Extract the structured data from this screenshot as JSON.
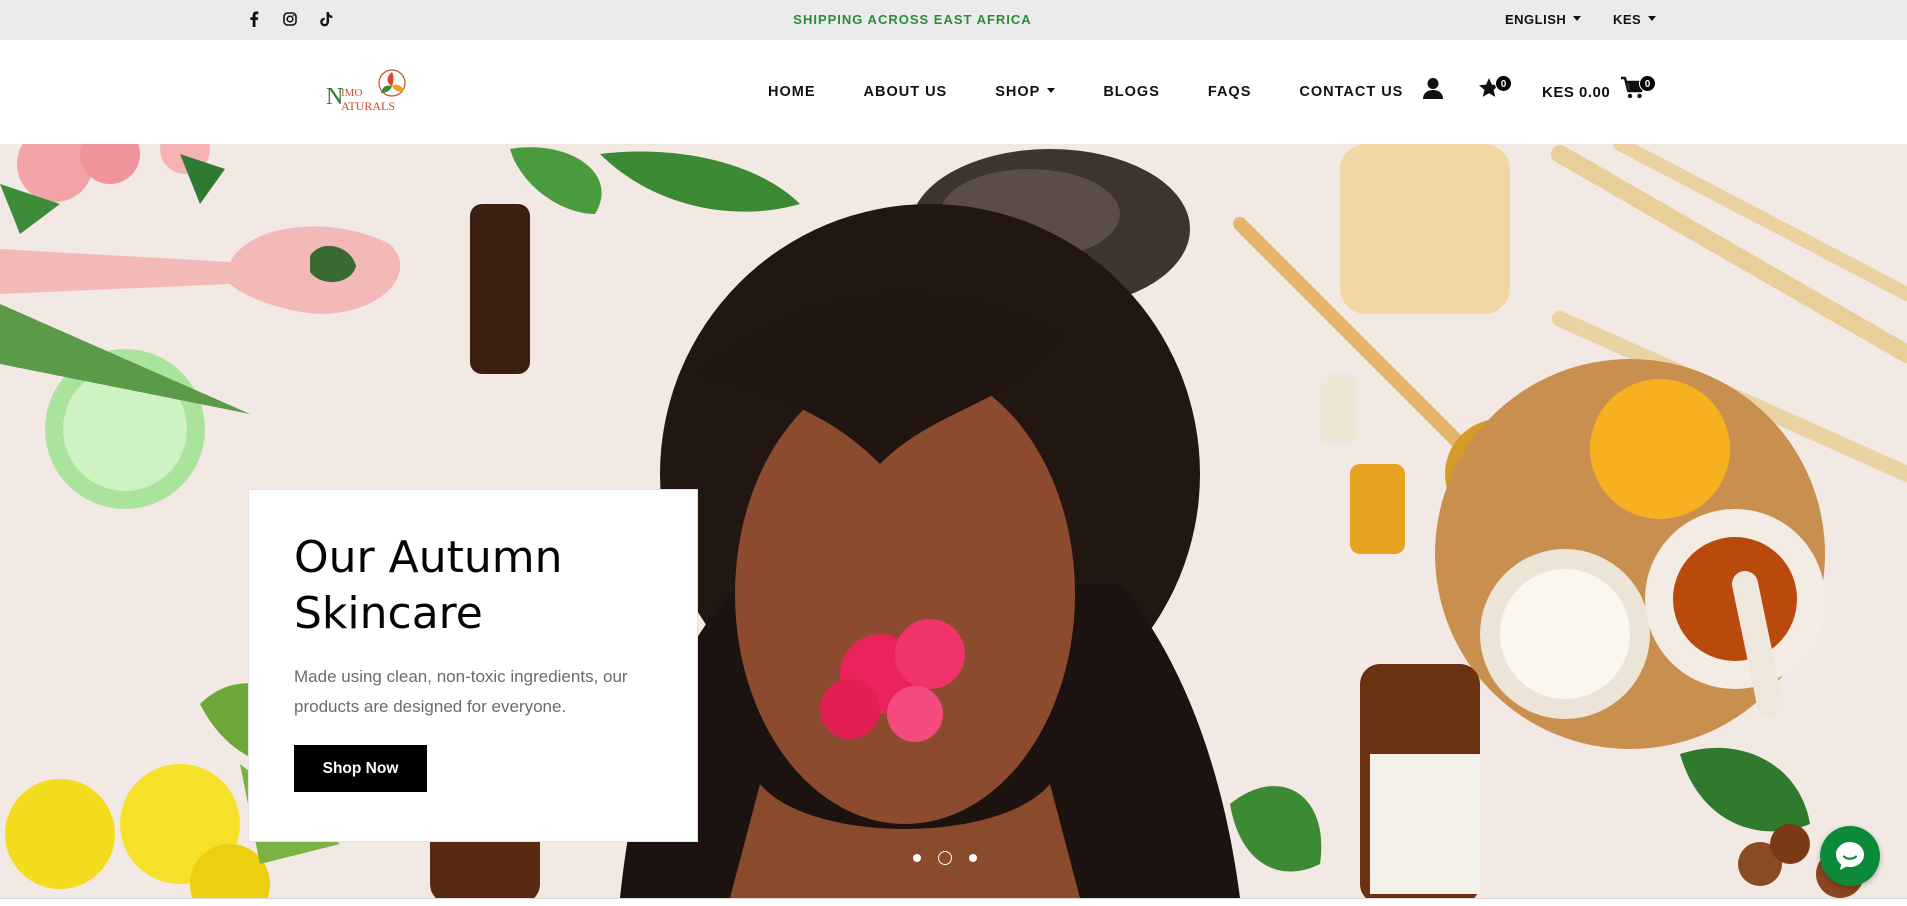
{
  "topbar": {
    "social": [
      {
        "icon": "facebook-icon"
      },
      {
        "icon": "instagram-icon"
      },
      {
        "icon": "tiktok-icon"
      }
    ],
    "shipping_text": "SHIPPING ACROSS EAST AFRICA",
    "language": "ENGLISH",
    "currency": "KES"
  },
  "header": {
    "logo_alt": "Nimo Naturals",
    "nav": [
      {
        "label": "HOME"
      },
      {
        "label": "ABOUT US"
      },
      {
        "label": "SHOP"
      },
      {
        "label": "BLOGS"
      },
      {
        "label": "FAQS"
      },
      {
        "label": "CONTACT US"
      }
    ],
    "wishlist_count": "0",
    "cart_total": "KES 0.00",
    "cart_count": "0"
  },
  "hero": {
    "title": "Our Autumn Skincare",
    "subtitle": "Made using clean, non-toxic ingredients, our products are designed for everyone.",
    "cta_label": "Shop Now",
    "slides_total": 3,
    "active_slide": 2
  },
  "colors": {
    "accent_green": "#2e8b3a",
    "chat_green": "#0c8a3a",
    "button_black": "#000000",
    "topbar_bg": "#e9eceb"
  }
}
